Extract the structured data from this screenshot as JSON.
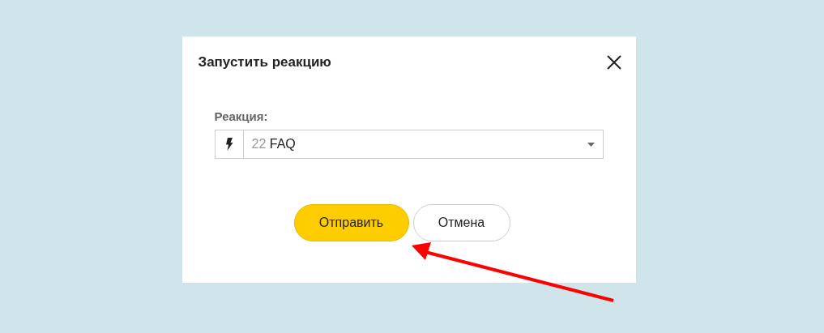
{
  "dialog": {
    "title": "Запустить реакцию",
    "field": {
      "label": "Реакция:",
      "value_number": "22",
      "value_text": "FAQ"
    },
    "buttons": [
      {
        "label": "Отправить",
        "kind": "primary"
      },
      {
        "label": "Отмена",
        "kind": "secondary"
      }
    ]
  },
  "annotation": {
    "kind": "arrow"
  }
}
